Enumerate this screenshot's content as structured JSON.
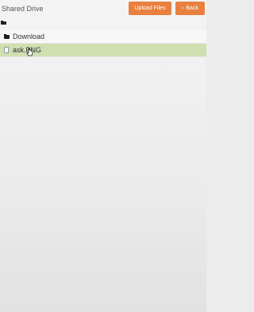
{
  "header": {
    "title": "Shared Drive",
    "upload_label": "Upload Files",
    "back_label": "Back",
    "back_icon": "chevron-left-icon",
    "accent_color": "#e9803e"
  },
  "path": {
    "icon": "folder-icon"
  },
  "files": [
    {
      "name": "Download",
      "type": "folder",
      "icon": "folder-icon",
      "selected": false
    },
    {
      "name": "ask.PNG",
      "type": "file",
      "icon": "file-icon",
      "selected": true
    }
  ],
  "colors": {
    "selected_row": "#cfdfb0"
  }
}
